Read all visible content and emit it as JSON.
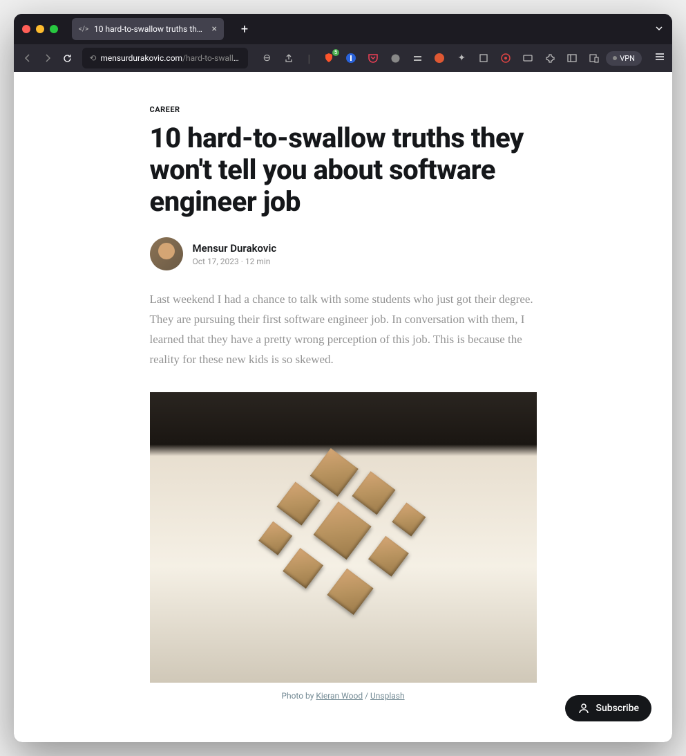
{
  "browser": {
    "tab_title": "10 hard-to-swallow truths they…",
    "url_host": "mensurdurakovic.com",
    "url_path": "/hard-to-swallow…",
    "shield_count": "5",
    "vpn_label": "VPN"
  },
  "article": {
    "category": "CAREER",
    "headline": "10 hard-to-swallow truths they won't tell you about software engineer job",
    "author": "Mensur Durakovic",
    "date": "Oct 17, 2023",
    "read_time": "12 min",
    "intro": "Last weekend I had a chance to talk with some students who just got their degree. They are pursuing their first software engineer job. In conversation with them, I learned that they have a pretty wrong perception of this job. This is because the reality for these new kids is so skewed.",
    "caption_prefix": "Photo by ",
    "caption_author": "Kieran Wood",
    "caption_sep": " / ",
    "caption_source": "Unsplash"
  },
  "subscribe_label": "Subscribe"
}
